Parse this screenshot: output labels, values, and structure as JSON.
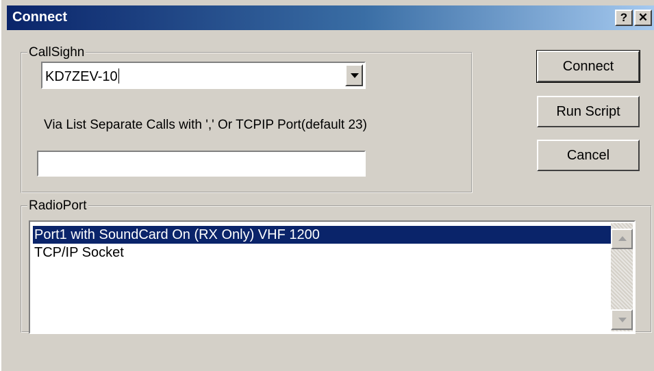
{
  "window": {
    "title": "Connect",
    "help_label": "?",
    "close_label": "✕"
  },
  "callsign_group": {
    "legend": "CallSighn",
    "combo_value": "KD7ZEV-10",
    "via_label": "Via List Separate Calls with ',' Or TCPIP Port(default 23)",
    "via_value": ""
  },
  "buttons": {
    "connect": "Connect",
    "run_script": "Run Script",
    "cancel": "Cancel"
  },
  "radioport_group": {
    "legend": "RadioPort",
    "items": [
      {
        "label": "Port1 with SoundCard On (RX Only) VHF 1200",
        "selected": true
      },
      {
        "label": "TCP/IP Socket",
        "selected": false
      }
    ]
  },
  "colors": {
    "selection": "#0a246a",
    "face": "#d4d0c8"
  }
}
